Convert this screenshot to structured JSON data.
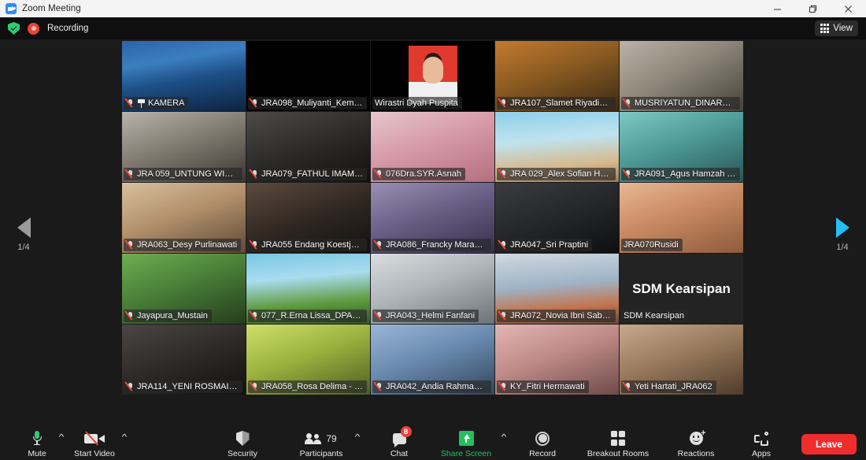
{
  "window": {
    "title": "Zoom Meeting",
    "logo_icon": "zoom-logo-icon",
    "minimize_icon": "minimize-icon",
    "maximize_icon": "restore-icon",
    "close_icon": "close-icon"
  },
  "header": {
    "encryption_icon": "shield-check-icon",
    "recording_icon": "recording-dot-icon",
    "recording_label": "Recording",
    "view_button": {
      "label": "View",
      "icon": "grid-view-icon"
    }
  },
  "stage": {
    "prev_page": {
      "icon": "left-arrow-icon",
      "label": "1/4",
      "color": "#9a9a9a"
    },
    "next_page": {
      "icon": "right-arrow-icon",
      "label": "1/4",
      "color": "#25bdf5"
    },
    "columns": 5,
    "rows": 5,
    "participants": [
      {
        "name": "KAMERA",
        "muted": true,
        "pinned": true,
        "active_speaker": true,
        "kind": "video",
        "bg": "bg-kamera"
      },
      {
        "name": "JRA098_Muliyanti_Kemen...",
        "muted": true,
        "pinned": false,
        "active_speaker": false,
        "kind": "black",
        "bg": "bg-black"
      },
      {
        "name": "Wirastri Dyah Puspita",
        "muted": false,
        "pinned": false,
        "active_speaker": false,
        "kind": "photo",
        "bg": "bg-redphoto"
      },
      {
        "name": "JRA107_Slamet Riyadi_LA...",
        "muted": true,
        "pinned": false,
        "active_speaker": false,
        "kind": "video",
        "bg": "bg-warm"
      },
      {
        "name": "MUSRIYATUN_DINARPUS...",
        "muted": true,
        "pinned": false,
        "active_speaker": false,
        "kind": "video",
        "bg": "bg-office"
      },
      {
        "name": "JRA 059_UNTUNG WINAR...",
        "muted": true,
        "pinned": false,
        "active_speaker": false,
        "kind": "video",
        "bg": "bg-grayroom"
      },
      {
        "name": "JRA079_FATHUL IMAM S...",
        "muted": true,
        "pinned": false,
        "active_speaker": false,
        "kind": "video",
        "bg": "bg-dark2"
      },
      {
        "name": "076Dra.SYR.Asnah",
        "muted": true,
        "pinned": false,
        "active_speaker": false,
        "kind": "video",
        "bg": "bg-pink"
      },
      {
        "name": "JRA 029_Alex Sofian Hadi...",
        "muted": true,
        "pinned": false,
        "active_speaker": false,
        "kind": "video",
        "bg": "bg-beach"
      },
      {
        "name": "JRA091_Agus Hamzah W...",
        "muted": true,
        "pinned": false,
        "active_speaker": false,
        "kind": "video",
        "bg": "bg-teal"
      },
      {
        "name": "JRA063_Desy Purlinawati",
        "muted": true,
        "pinned": false,
        "active_speaker": false,
        "kind": "video",
        "bg": "bg-tan"
      },
      {
        "name": "JRA055 Endang Koestjah...",
        "muted": true,
        "pinned": false,
        "active_speaker": false,
        "kind": "video",
        "bg": "bg-dark3"
      },
      {
        "name": "JRA086_Francky Marantika",
        "muted": true,
        "pinned": false,
        "active_speaker": false,
        "kind": "video",
        "bg": "bg-purple"
      },
      {
        "name": "JRA047_Sri Praptini",
        "muted": true,
        "pinned": false,
        "active_speaker": false,
        "kind": "video",
        "bg": "bg-dark4"
      },
      {
        "name": "JRA070Rusidi",
        "muted": false,
        "pinned": false,
        "active_speaker": false,
        "kind": "video",
        "bg": "bg-skin"
      },
      {
        "name": "Jayapura_Mustain",
        "muted": true,
        "pinned": false,
        "active_speaker": false,
        "kind": "video",
        "bg": "bg-green"
      },
      {
        "name": "077_R.Erna Lissa_DPAD Pr...",
        "muted": true,
        "pinned": false,
        "active_speaker": false,
        "kind": "video",
        "bg": "bg-tropic"
      },
      {
        "name": "JRA043_Helmi Fanfani",
        "muted": true,
        "pinned": false,
        "active_speaker": false,
        "kind": "video",
        "bg": "bg-lightroom"
      },
      {
        "name": "JRA072_Novia Ibni Sabil_...",
        "muted": true,
        "pinned": false,
        "active_speaker": false,
        "kind": "video",
        "bg": "bg-bridge"
      },
      {
        "name": "SDM Kearsipan",
        "muted": false,
        "pinned": false,
        "active_speaker": false,
        "kind": "text",
        "display_text": "SDM Kearsipan",
        "bg": "bg-textslide"
      },
      {
        "name": "JRA114_YENI ROSMAINI,S...",
        "muted": true,
        "pinned": false,
        "active_speaker": false,
        "kind": "video",
        "bg": "bg-dark5"
      },
      {
        "name": "JRA058_Rosa Delima - DI...",
        "muted": true,
        "pinned": false,
        "active_speaker": false,
        "kind": "video",
        "bg": "bg-lime"
      },
      {
        "name": "JRA042_Andia Rahma_Ta...",
        "muted": true,
        "pinned": false,
        "active_speaker": false,
        "kind": "video",
        "bg": "bg-blue"
      },
      {
        "name": "KY_Fitri Hermawati",
        "muted": true,
        "pinned": false,
        "active_speaker": false,
        "kind": "video",
        "bg": "bg-rose"
      },
      {
        "name": "Yeti Hartati_JRA062",
        "muted": true,
        "pinned": false,
        "active_speaker": false,
        "kind": "video",
        "bg": "bg-brown"
      }
    ]
  },
  "toolbar": {
    "mute": {
      "label": "Mute",
      "icon": "microphone-icon",
      "has_caret": true
    },
    "video": {
      "label": "Start Video",
      "icon": "camera-off-icon",
      "has_caret": true
    },
    "security": {
      "label": "Security",
      "icon": "shield-icon"
    },
    "participants": {
      "label": "Participants",
      "icon": "people-icon",
      "count": "79",
      "has_caret": true
    },
    "chat": {
      "label": "Chat",
      "icon": "chat-bubble-icon",
      "badge": "8"
    },
    "share": {
      "label": "Share Screen",
      "icon": "share-screen-icon",
      "color": "#22c15e",
      "has_caret": true
    },
    "record": {
      "label": "Record",
      "icon": "record-circle-icon"
    },
    "breakout": {
      "label": "Breakout Rooms",
      "icon": "breakout-rooms-icon"
    },
    "reactions": {
      "label": "Reactions",
      "icon": "reactions-smiley-icon"
    },
    "apps": {
      "label": "Apps",
      "icon": "apps-icon"
    },
    "leave": {
      "label": "Leave",
      "color": "#f02d2d"
    }
  }
}
